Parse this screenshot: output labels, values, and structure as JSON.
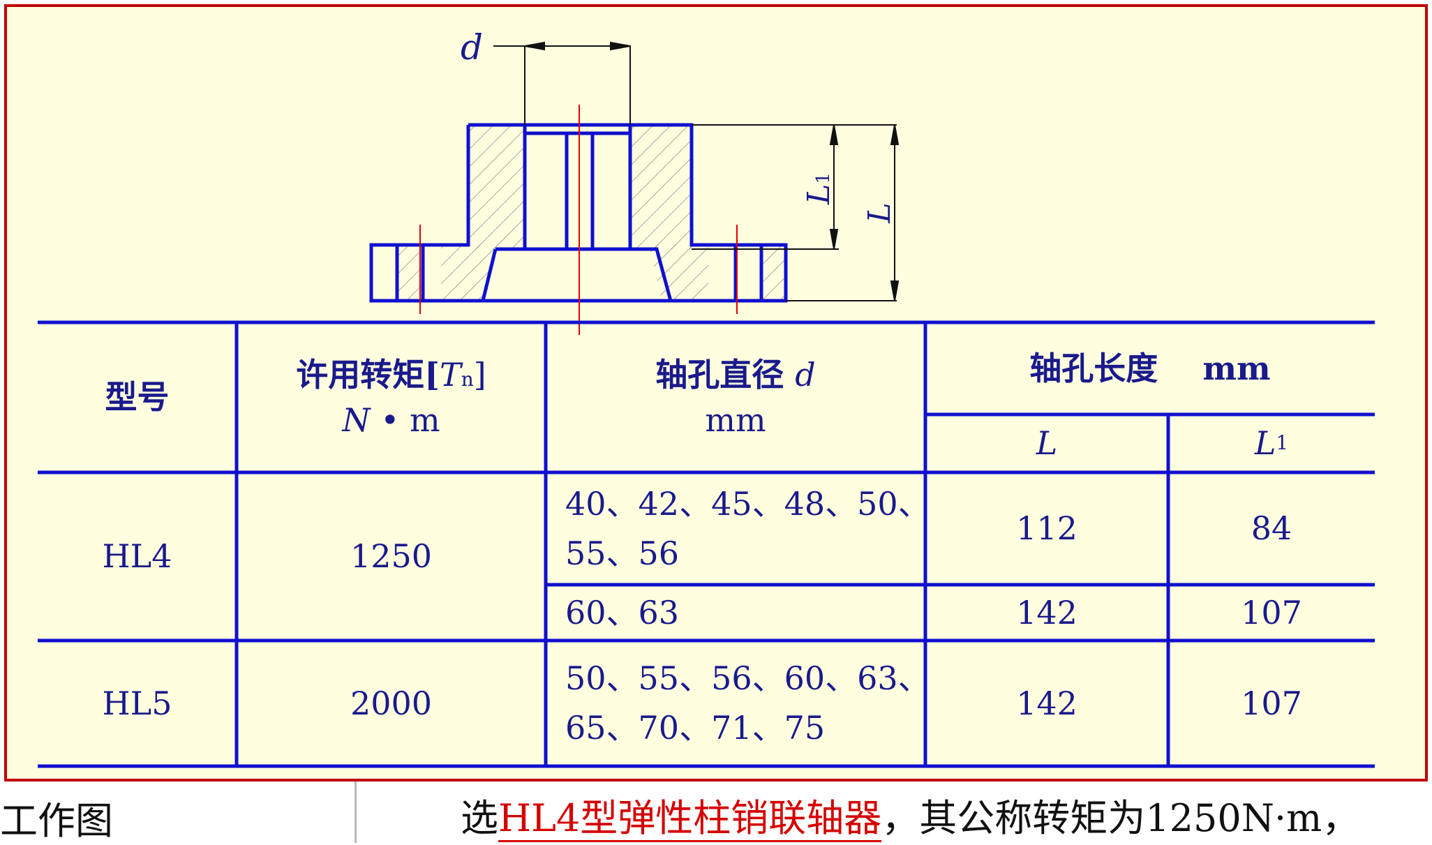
{
  "drawing": {
    "label_d": "d",
    "label_L1": "L",
    "label_L1_sub": "1",
    "label_L": "L"
  },
  "table": {
    "headers": {
      "model": "型号",
      "torque_main": "许用转矩[",
      "torque_T": "T",
      "torque_sub": "n",
      "torque_close": "]",
      "torque_unit_N": "N",
      "torque_unit_rest": " • m",
      "bore_main": "轴孔直径",
      "bore_d": "d",
      "bore_unit": "mm",
      "length_main": "轴孔长度    mm",
      "length_L": "L",
      "length_L1": "L",
      "length_L1_sub": "1"
    },
    "rows": [
      {
        "model": "HL4",
        "torque": "1250",
        "sub": [
          {
            "bores_line1": "40、42、45、48、50、",
            "bores_line2": "55、56",
            "L": "112",
            "L1": "84"
          },
          {
            "bores_line1": "60、63",
            "L": "142",
            "L1": "107"
          }
        ]
      },
      {
        "model": "HL5",
        "torque": "2000",
        "sub": [
          {
            "bores_line1": "50、55、56、60、63、",
            "bores_line2": "65、70、71、75",
            "L": "142",
            "L1": "107"
          }
        ]
      }
    ]
  },
  "bottom": {
    "left_label": "工作图",
    "sentence_prefix": "选",
    "highlight": "HL4型弹性柱销联轴器",
    "sentence_suffix": "，其公称转矩为1250N·m，"
  },
  "colors": {
    "panel_bg": "#ffffe0",
    "line_blue": "#1010d0",
    "text_navy": "#1a1a8c",
    "border_red": "#c00000",
    "highlight_red": "#d40000"
  }
}
